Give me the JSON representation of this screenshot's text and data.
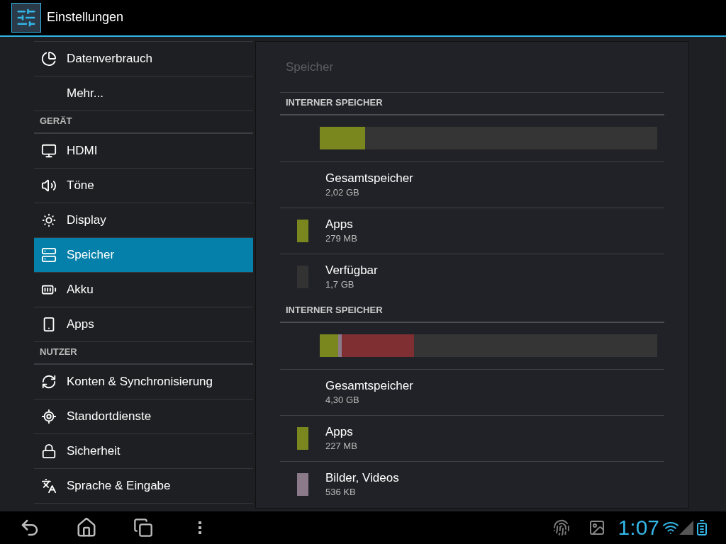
{
  "action_bar": {
    "title": "Einstellungen"
  },
  "sidebar": {
    "items": [
      {
        "kind": "item",
        "label": "Datenverbrauch",
        "selected": false
      },
      {
        "kind": "item",
        "label": "Mehr...",
        "selected": false
      },
      {
        "kind": "header",
        "label": "GERÄT"
      },
      {
        "kind": "item",
        "label": "HDMI",
        "selected": false
      },
      {
        "kind": "item",
        "label": "Töne",
        "selected": false
      },
      {
        "kind": "item",
        "label": "Display",
        "selected": false
      },
      {
        "kind": "item",
        "label": "Speicher",
        "selected": true
      },
      {
        "kind": "item",
        "label": "Akku",
        "selected": false
      },
      {
        "kind": "item",
        "label": "Apps",
        "selected": false
      },
      {
        "kind": "header",
        "label": "NUTZER"
      },
      {
        "kind": "item",
        "label": "Konten & Synchronisierung",
        "selected": false
      },
      {
        "kind": "item",
        "label": "Standortdienste",
        "selected": false
      },
      {
        "kind": "item",
        "label": "Sicherheit",
        "selected": false
      },
      {
        "kind": "item",
        "label": "Sprache & Eingabe",
        "selected": false
      }
    ]
  },
  "panel": {
    "title": "Speicher",
    "sections": [
      {
        "header": "INTERNER SPEICHER",
        "bar": [
          {
            "color": "#7a871f",
            "level": 0.134
          }
        ],
        "rows": [
          {
            "kind": "total",
            "label": "Gesamtspeicher",
            "value": "2,02 GB"
          },
          {
            "kind": "category",
            "label": "Apps",
            "value": "279 MB",
            "color": "#7a871f"
          },
          {
            "kind": "category",
            "label": "Verfügbar",
            "value": "1,7 GB",
            "color": "#333333"
          }
        ]
      },
      {
        "header": "INTERNER SPEICHER",
        "bar": [
          {
            "color": "#7a871f",
            "level": 0.054
          },
          {
            "color": "#8a7a8a",
            "level": 0.012
          },
          {
            "color": "#7f2f32",
            "level": 0.214
          }
        ],
        "rows": [
          {
            "kind": "total",
            "label": "Gesamtspeicher",
            "value": "4,30 GB"
          },
          {
            "kind": "category",
            "label": "Apps",
            "value": "227 MB",
            "color": "#7a871f"
          },
          {
            "kind": "category",
            "label": "Bilder, Videos",
            "value": "536 KB",
            "color": "#8a7a8a"
          }
        ]
      }
    ]
  },
  "nav_bar": {
    "clock": "1:07"
  }
}
